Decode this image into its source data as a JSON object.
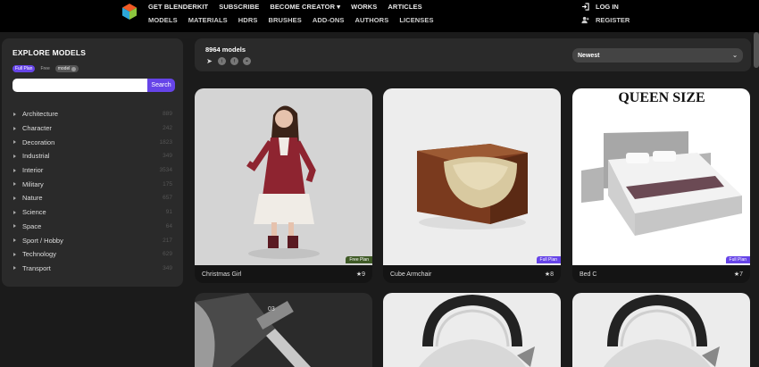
{
  "nav": {
    "row1": [
      "GET BLENDERKIT",
      "SUBSCRIBE",
      "BECOME CREATOR ▾",
      "WORKS",
      "ARTICLES"
    ],
    "row2": [
      "MODELS",
      "MATERIALS",
      "HDRS",
      "BRUSHES",
      "ADD-ONS",
      "AUTHORS",
      "LICENSES"
    ],
    "login": "LOG IN",
    "register": "REGISTER"
  },
  "sidebar": {
    "title": "EXPLORE MODELS",
    "filters": {
      "full_plan": "Full Plan",
      "free": "Free",
      "model": "model"
    },
    "search_placeholder": "",
    "search_button": "Search",
    "categories": [
      {
        "name": "Architecture",
        "count": "889"
      },
      {
        "name": "Character",
        "count": "242"
      },
      {
        "name": "Decoration",
        "count": "1823"
      },
      {
        "name": "Industrial",
        "count": "349"
      },
      {
        "name": "Interior",
        "count": "3534"
      },
      {
        "name": "Military",
        "count": "175"
      },
      {
        "name": "Nature",
        "count": "657"
      },
      {
        "name": "Science",
        "count": "91"
      },
      {
        "name": "Space",
        "count": "64"
      },
      {
        "name": "Sport / Hobby",
        "count": "217"
      },
      {
        "name": "Technology",
        "count": "629"
      },
      {
        "name": "Transport",
        "count": "349"
      }
    ]
  },
  "toolbar": {
    "count": "8964 models",
    "sort": "Newest"
  },
  "cards": [
    {
      "name": "Christmas Girl",
      "rating": "★9",
      "badge": "Free Plan"
    },
    {
      "name": "Cube Armchair",
      "rating": "★8",
      "badge": "Full Plan"
    },
    {
      "name": "Bed C",
      "rating": "★7",
      "badge": "Full Plan",
      "image_text": "QUEEN SIZE"
    },
    {
      "name": "",
      "rating": "",
      "badge": "",
      "image_text": "03"
    },
    {
      "name": "",
      "rating": "",
      "badge": ""
    },
    {
      "name": "",
      "rating": "",
      "badge": ""
    }
  ],
  "colors": {
    "accent": "#6644e8",
    "free_badge": "#3f5a26",
    "bg": "#1b1b1b",
    "panel": "#2a2a2a"
  }
}
